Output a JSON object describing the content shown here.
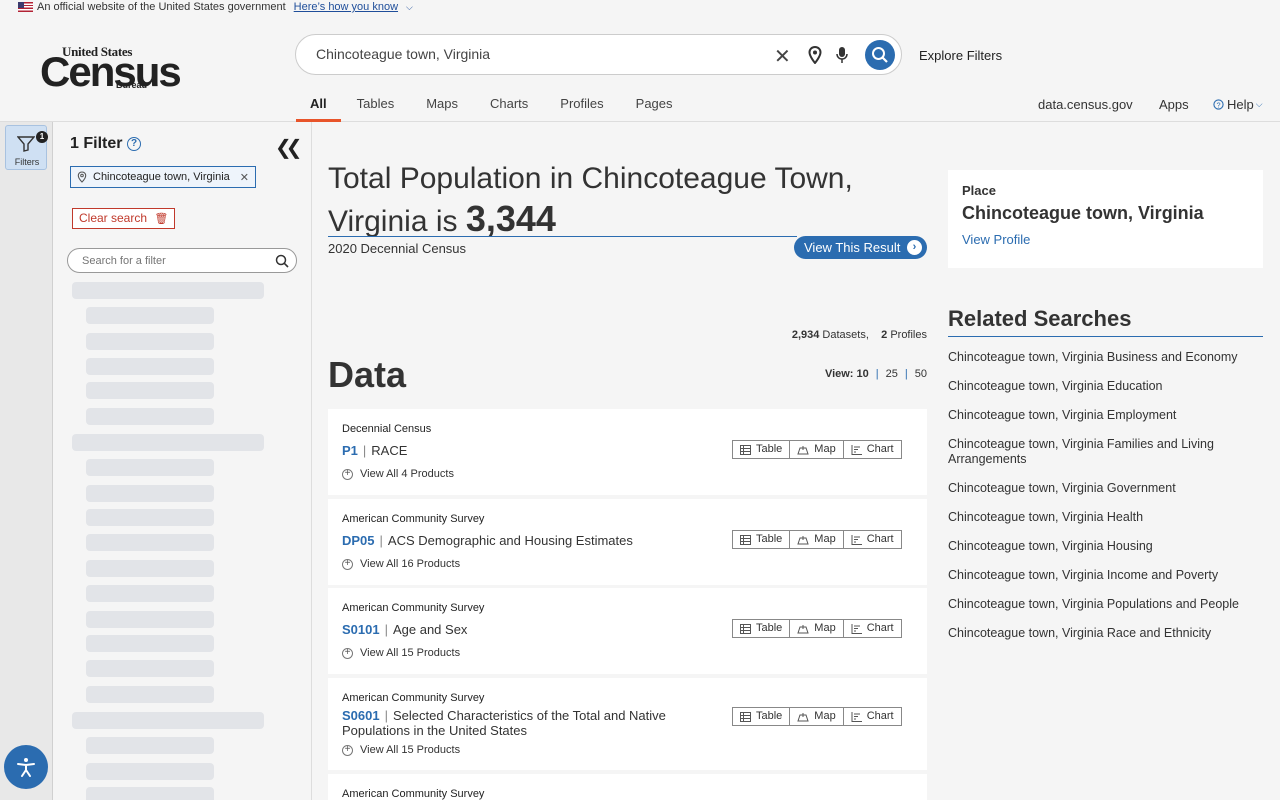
{
  "gov_banner": {
    "text": "An official website of the United States government",
    "link": "Here’s how you know"
  },
  "logo": {
    "line1": "United States",
    "line2": "Census",
    "line3": "Bureau"
  },
  "search": {
    "value": "Chincoteague town, Virginia"
  },
  "explore_filters": "Explore Filters",
  "tabs": [
    "All",
    "Tables",
    "Maps",
    "Charts",
    "Profiles",
    "Pages"
  ],
  "active_tab": "All",
  "header_links": {
    "site": "data.census.gov",
    "apps": "Apps",
    "help": "Help"
  },
  "rail": {
    "filters_label": "Filters",
    "filters_count": "1"
  },
  "filter_panel": {
    "title": "1 Filter",
    "chip": "Chincoteague town, Virginia",
    "clear": "Clear search",
    "search_placeholder": "Search for a filter"
  },
  "result": {
    "title_prefix": "Total Population in Chincoteague Town, Virginia is",
    "value": "3,344",
    "source": "2020 Decennial Census",
    "button": "View This Result"
  },
  "counts": {
    "datasets_n": "2,934",
    "datasets": "Datasets,",
    "profiles_n": "2",
    "profiles": "Profiles"
  },
  "data_heading": "Data",
  "view_select": {
    "label": "View:",
    "options": [
      "10",
      "25",
      "50"
    ],
    "selected": "10"
  },
  "cards": [
    {
      "survey": "Decennial Census",
      "code": "P1",
      "name": "RACE",
      "view_all": "View All 4 Products"
    },
    {
      "survey": "American Community Survey",
      "code": "DP05",
      "name": "ACS Demographic and Housing Estimates",
      "view_all": "View All 16 Products"
    },
    {
      "survey": "American Community Survey",
      "code": "S0101",
      "name": "Age and Sex",
      "view_all": "View All 15 Products"
    },
    {
      "survey": "American Community Survey",
      "code": "S0601",
      "name": "Selected Characteristics of the Total and Native Populations in the United States",
      "view_all": "View All 15 Products"
    },
    {
      "survey": "American Community Survey"
    }
  ],
  "card_buttons": {
    "table": "Table",
    "map": "Map",
    "chart": "Chart"
  },
  "place": {
    "kind": "Place",
    "name": "Chincoteague town, Virginia",
    "link": "View Profile"
  },
  "related": {
    "heading": "Related Searches",
    "items": [
      "Chincoteague town, Virginia Business and Economy",
      "Chincoteague town, Virginia Education",
      "Chincoteague town, Virginia Employment",
      "Chincoteague town, Virginia Families and Living Arrangements",
      "Chincoteague town, Virginia Government",
      "Chincoteague town, Virginia Health",
      "Chincoteague town, Virginia Housing",
      "Chincoteague town, Virginia Income and Poverty",
      "Chincoteague town, Virginia Populations and People",
      "Chincoteague town, Virginia Race and Ethnicity"
    ]
  },
  "colors": {
    "accent": "#2b6cb0",
    "tab_underline": "#e8542a",
    "danger": "#c0392b"
  }
}
